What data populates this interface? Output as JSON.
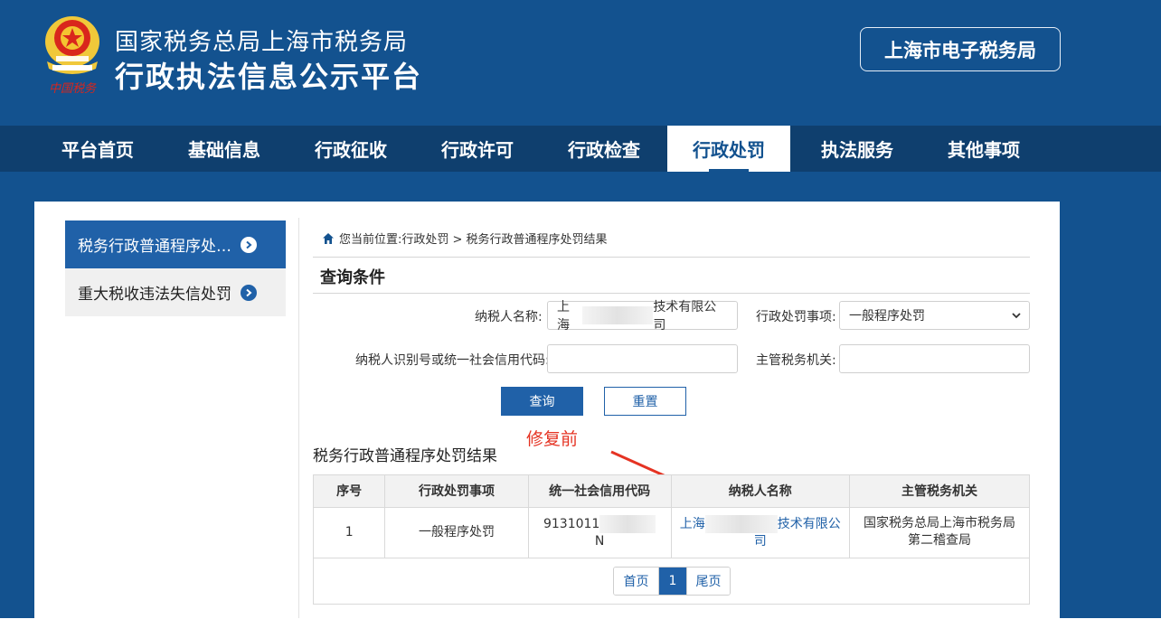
{
  "header": {
    "title_line1": "国家税务总局上海市税务局",
    "title_line2": "行政执法信息公示平台",
    "etax_button": "上海市电子税务局",
    "logo_caption": "中国税务"
  },
  "nav": {
    "items": [
      "平台首页",
      "基础信息",
      "行政征收",
      "行政许可",
      "行政检查",
      "行政处罚",
      "执法服务",
      "其他事项"
    ],
    "active": "行政处罚"
  },
  "sidebar": {
    "items": [
      {
        "label": "税务行政普通程序处罚结果",
        "active": true
      },
      {
        "label": "重大税收违法失信处罚",
        "active": false
      }
    ]
  },
  "breadcrumb": {
    "prefix": "您当前位置:",
    "path": "行政处罚 > 税务行政普通程序处罚结果"
  },
  "query": {
    "section_title": "查询条件",
    "taxpayer_name_label": "纳税人名称:",
    "taxpayer_name_prefix": "上海",
    "taxpayer_name_suffix": "技术有限公司",
    "penalty_item_label": "行政处罚事项:",
    "penalty_item_value": "一般程序处罚",
    "taxpayer_id_label": "纳税人识别号或统一社会信用代码:",
    "taxpayer_id_value": "",
    "authority_label": "主管税务机关:",
    "authority_value": "",
    "query_button": "查询",
    "reset_button": "重置"
  },
  "annotation": {
    "text": "修复前",
    "color": "#e53323"
  },
  "results": {
    "title": "税务行政普通程序处罚结果",
    "columns": [
      "序号",
      "行政处罚事项",
      "统一社会信用代码",
      "纳税人名称",
      "主管税务机关"
    ],
    "rows": [
      {
        "index": "1",
        "penalty_item": "一般程序处罚",
        "credit_code_prefix": "9131011",
        "credit_code_suffix": "N",
        "name_prefix": "上海",
        "name_suffix": "技术有限公司",
        "authority": "国家税务总局上海市税务局第二稽查局"
      }
    ]
  },
  "pager": {
    "first": "首页",
    "current": "1",
    "last": "尾页"
  },
  "colors": {
    "brand": "#13528f",
    "nav_bg": "#0f3f6e",
    "accent": "#2061a8"
  }
}
